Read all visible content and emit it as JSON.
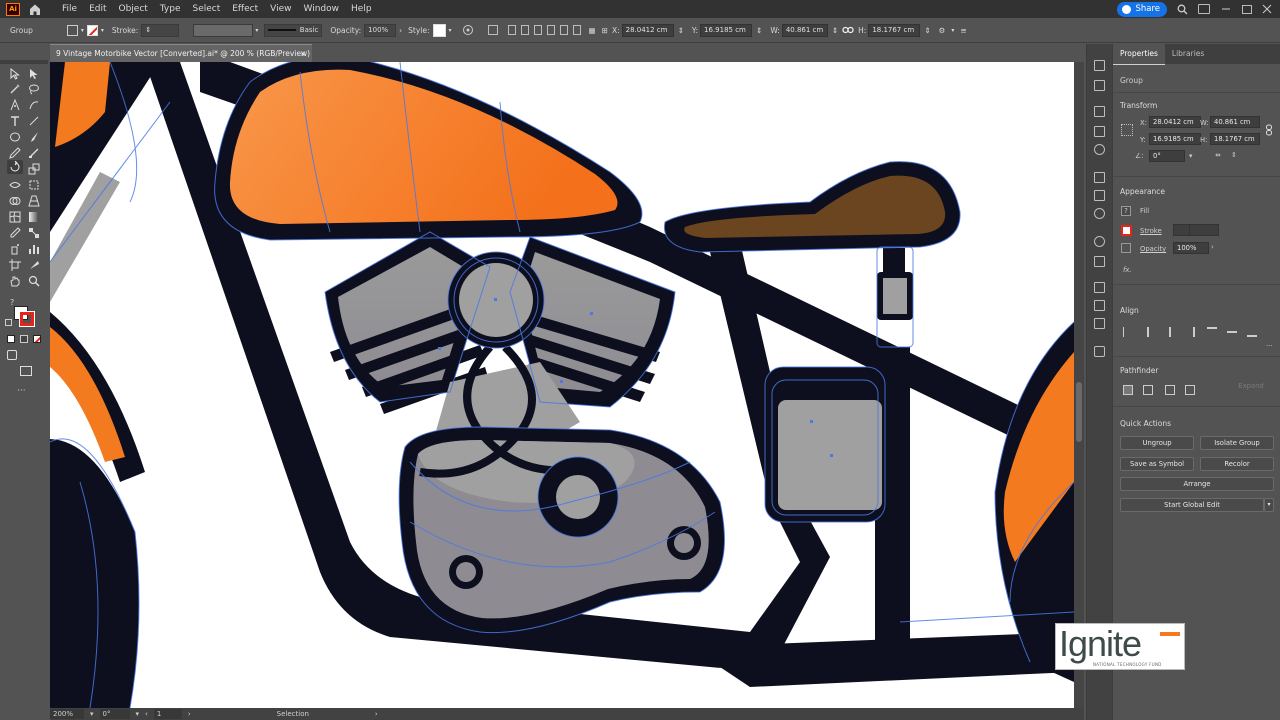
{
  "menubar": {
    "app_logo": "Ai",
    "menus": [
      "File",
      "Edit",
      "Object",
      "Type",
      "Select",
      "Effect",
      "View",
      "Window",
      "Help"
    ],
    "share_label": "Share"
  },
  "controlbar": {
    "selection_type": "Group",
    "stroke_label": "Stroke:",
    "brush_label": "Basic",
    "opacity_label": "Opacity:",
    "opacity_value": "100%",
    "style_label": "Style:",
    "x_label": "X:",
    "x_value": "28.0412 cm",
    "y_label": "Y:",
    "y_value": "16.9185 cm",
    "w_label": "W:",
    "w_value": "40.861 cm",
    "h_label": "H:",
    "h_value": "18.1767 cm"
  },
  "document": {
    "tab_title": "9 Vintage Motorbike Vector [Converted].ai* @ 200 % (RGB/Preview)",
    "close_glyph": "×"
  },
  "statusbar": {
    "zoom": "200%",
    "rotation": "0°",
    "artboard": "1",
    "tool_name": "Selection"
  },
  "properties": {
    "tab_properties": "Properties",
    "tab_libraries": "Libraries",
    "selection": "Group",
    "transform_title": "Transform",
    "x_label": "X:",
    "x_value": "28.0412 cm",
    "y_label": "Y:",
    "y_value": "16.9185 cm",
    "w_label": "W:",
    "w_value": "40.861 cm",
    "h_label": "H:",
    "h_value": "18.1767 cm",
    "angle_label": "∠:",
    "angle_value": "0°",
    "appearance_title": "Appearance",
    "fill_label": "Fill",
    "stroke_label": "Stroke",
    "opacity_label": "Opacity",
    "opacity_value": "100%",
    "fx_label": "fx.",
    "align_title": "Align",
    "pathfinder_title": "Pathfinder",
    "expand_label": "Expand",
    "quick_actions_title": "Quick Actions",
    "ungroup_label": "Ungroup",
    "isolate_label": "Isolate Group",
    "save_symbol_label": "Save as Symbol",
    "recolor_label": "Recolor",
    "arrange_label": "Arrange",
    "global_edit_label": "Start Global Edit"
  },
  "watermark": {
    "brand": "Ignite",
    "tagline": "NATIONAL TECHNOLOGY FUND"
  },
  "colors": {
    "orange": "#f47a20",
    "brown": "#6b4420",
    "engine_gray": "#a0a0a0",
    "outline": "#0d0f1e",
    "selection_blue": "#4a78e6",
    "share_blue": "#1473e6"
  }
}
